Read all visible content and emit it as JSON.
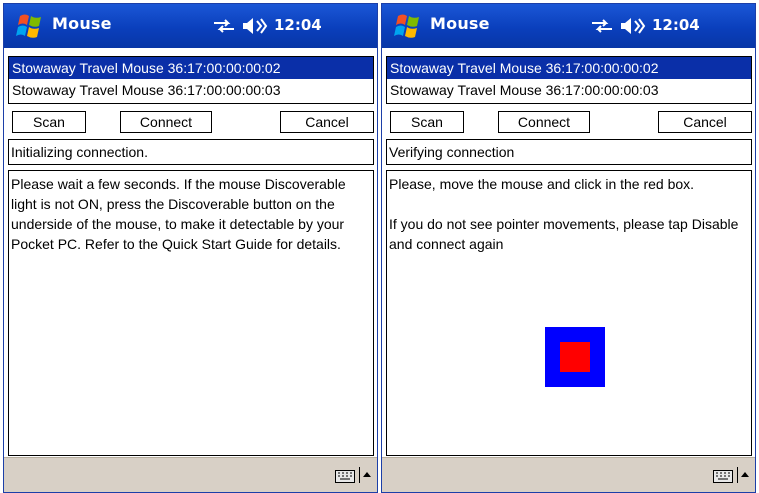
{
  "screens": [
    {
      "app_title": "Mouse",
      "clock": "12:04",
      "devices": [
        "Stowaway Travel Mouse 36:17:00:00:00:02",
        "Stowaway Travel Mouse 36:17:00:00:00:03"
      ],
      "selected_device_index": 0,
      "buttons": {
        "scan": "Scan",
        "connect": "Connect",
        "cancel": "Cancel"
      },
      "status": "Initializing connection.",
      "message": [
        "Please wait a few seconds. If the mouse Discoverable light is not ON, press the Discoverable button on the underside of the mouse, to make it detectable by your Pocket PC. Refer to the Quick Start Guide for details."
      ]
    },
    {
      "app_title": "Mouse",
      "clock": "12:04",
      "devices": [
        "Stowaway Travel Mouse 36:17:00:00:00:02",
        "Stowaway Travel Mouse 36:17:00:00:00:03"
      ],
      "selected_device_index": 0,
      "buttons": {
        "scan": "Scan",
        "connect": "Connect",
        "cancel": "Cancel"
      },
      "status": "Verifying connection",
      "message": [
        "Please, move the mouse and click in the red box.",
        "If you do not see pointer movements, please tap Disable and connect again"
      ],
      "target_box": {
        "outer_color": "#0000ff",
        "inner_color": "#ff0000"
      }
    }
  ],
  "colors": {
    "titlebar": "#0a3fbc",
    "selection": "#0a2fa8",
    "bottombar": "#d8d0c6"
  },
  "icons": [
    "windows-start-icon",
    "sync-icon",
    "speaker-icon",
    "keyboard-icon",
    "sip-arrow-icon"
  ]
}
